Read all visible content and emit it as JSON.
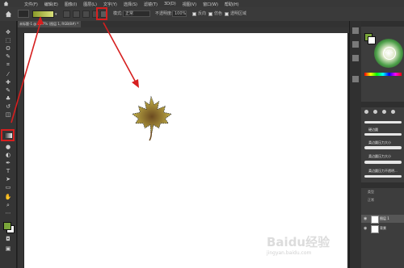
{
  "menubar": {
    "items": [
      "文件(F)",
      "编辑(E)",
      "图像(I)",
      "图层(L)",
      "文字(Y)",
      "选择(S)",
      "滤镜(T)",
      "3D(D)",
      "视图(V)",
      "窗口(W)",
      "帮助(H)"
    ]
  },
  "options": {
    "mode_label": "模式:",
    "mode_value": "正常",
    "opacity_label": "不透明度:",
    "opacity_value": "100%",
    "reverse_label": "反向",
    "dither_label": "仿色",
    "transparency_label": "透明区域"
  },
  "document": {
    "tab_title": "未标题-1 @ 13.7% (图层 1, RGB/8#) *"
  },
  "color_panel": {
    "percent": "50%"
  },
  "brushes_panel": {
    "items": [
      "硬边圆",
      "柔边圆压力大小",
      "柔边圆压力大小",
      "柔边圆压力不透明..."
    ]
  },
  "layers_panel": {
    "kind_label": "类型",
    "blend_label": "正常",
    "layers": [
      "图层 1",
      "背景"
    ]
  },
  "watermark": "Baidu经验",
  "watermark_sub": "jingyan.baidu.com",
  "colors": {
    "annotation": "#d61f1f",
    "leaf_top": "#c8b84a",
    "leaf_bottom": "#6b4a20"
  }
}
